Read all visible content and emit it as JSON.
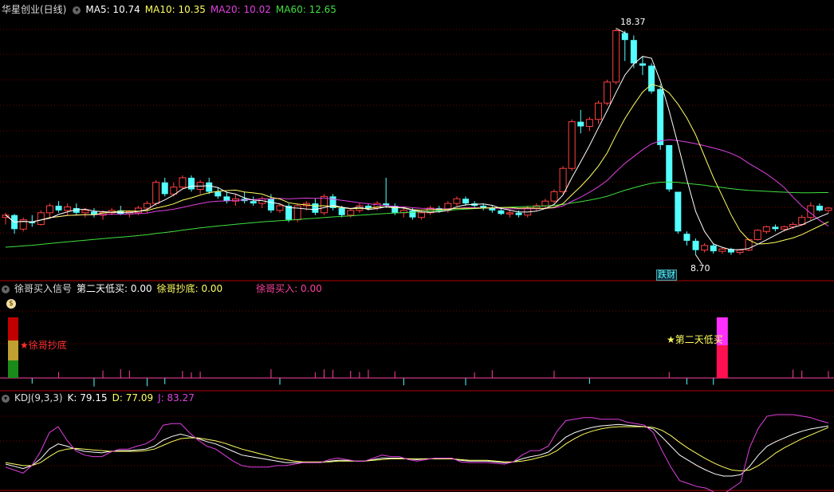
{
  "main_header": {
    "stock": "华星创业(日线)",
    "ma5": "MA5: 10.74",
    "ma10": "MA10: 10.35",
    "ma20": "MA20: 10.02",
    "ma60": "MA60: 12.65"
  },
  "signal_header": {
    "name": "徐哥买入信号",
    "day2": "第二天低买: 0.00",
    "bottom": "徐哥抄底: 0.00",
    "buy": "徐哥买入: 0.00"
  },
  "kdj_header": {
    "name": "KDJ(9,3,3)",
    "k": "K: 79.15",
    "d": "D: 77.09",
    "j": "J: 83.27"
  },
  "annotations": {
    "high": "18.37",
    "low": "8.70",
    "badge": "跌财",
    "signal1": "★徐哥抄底",
    "signal2": "★第二天低买"
  },
  "colors": {
    "up": "#ff4040",
    "down": "#54ffff",
    "ma5": "#ffffff",
    "ma10": "#ffff60",
    "ma20": "#e040e0",
    "ma60": "#40e040",
    "grid": "#7a0000",
    "axis": "#b00000"
  },
  "chart_data": [
    {
      "type": "candlestick",
      "title": "华星创业(日线)",
      "ylim": [
        8.0,
        19.0
      ],
      "candles": [
        [
          10.3,
          10.5,
          10.0,
          10.4
        ],
        [
          10.4,
          10.45,
          9.6,
          9.8
        ],
        [
          9.8,
          10.3,
          9.7,
          10.2
        ],
        [
          10.1,
          10.4,
          9.9,
          10.05
        ],
        [
          10.0,
          10.6,
          9.95,
          10.5
        ],
        [
          10.5,
          10.9,
          10.3,
          10.8
        ],
        [
          10.8,
          11.0,
          10.5,
          10.6
        ],
        [
          10.6,
          10.9,
          10.4,
          10.75
        ],
        [
          10.7,
          10.9,
          10.4,
          10.5
        ],
        [
          10.5,
          10.7,
          10.3,
          10.6
        ],
        [
          10.55,
          10.7,
          10.3,
          10.4
        ],
        [
          10.4,
          10.6,
          10.2,
          10.5
        ],
        [
          10.5,
          10.7,
          10.4,
          10.6
        ],
        [
          10.6,
          10.8,
          10.4,
          10.45
        ],
        [
          10.45,
          10.6,
          10.3,
          10.55
        ],
        [
          10.5,
          10.8,
          10.4,
          10.7
        ],
        [
          10.7,
          11.0,
          10.5,
          10.9
        ],
        [
          10.9,
          11.9,
          10.8,
          11.8
        ],
        [
          11.8,
          12.0,
          11.2,
          11.3
        ],
        [
          11.3,
          11.8,
          11.2,
          11.6
        ],
        [
          11.6,
          12.1,
          11.5,
          12.0
        ],
        [
          12.0,
          12.1,
          11.4,
          11.5
        ],
        [
          11.5,
          11.9,
          11.3,
          11.8
        ],
        [
          11.8,
          12.0,
          11.3,
          11.4
        ],
        [
          11.4,
          11.6,
          11.1,
          11.2
        ],
        [
          11.2,
          11.4,
          10.9,
          11.0
        ],
        [
          11.0,
          11.3,
          10.8,
          11.1
        ],
        [
          11.1,
          11.4,
          10.9,
          11.0
        ],
        [
          11.0,
          11.2,
          10.8,
          10.9
        ],
        [
          10.9,
          11.2,
          10.7,
          11.1
        ],
        [
          11.1,
          11.3,
          10.5,
          10.6
        ],
        [
          10.6,
          10.9,
          10.5,
          10.8
        ],
        [
          10.8,
          10.9,
          10.1,
          10.2
        ],
        [
          10.2,
          10.9,
          10.1,
          10.8
        ],
        [
          10.8,
          11.0,
          10.6,
          10.9
        ],
        [
          10.9,
          11.1,
          10.4,
          10.5
        ],
        [
          10.5,
          11.3,
          10.4,
          11.2
        ],
        [
          11.2,
          11.3,
          10.6,
          10.7
        ],
        [
          10.7,
          10.8,
          10.3,
          10.4
        ],
        [
          10.4,
          10.7,
          10.3,
          10.6
        ],
        [
          10.6,
          10.9,
          10.5,
          10.8
        ],
        [
          10.8,
          10.9,
          10.6,
          10.7
        ],
        [
          10.7,
          11.0,
          10.6,
          10.9
        ],
        [
          10.9,
          12.0,
          10.7,
          10.8
        ],
        [
          10.8,
          10.9,
          10.4,
          10.5
        ],
        [
          10.5,
          10.7,
          10.3,
          10.6
        ],
        [
          10.6,
          10.7,
          10.2,
          10.3
        ],
        [
          10.3,
          10.6,
          10.2,
          10.5
        ],
        [
          10.5,
          10.8,
          10.4,
          10.7
        ],
        [
          10.7,
          10.8,
          10.5,
          10.6
        ],
        [
          10.6,
          11.0,
          10.5,
          10.9
        ],
        [
          10.9,
          11.2,
          10.8,
          11.1
        ],
        [
          11.1,
          11.2,
          10.8,
          10.9
        ],
        [
          10.9,
          11.0,
          10.7,
          10.8
        ],
        [
          10.8,
          10.9,
          10.6,
          10.7
        ],
        [
          10.7,
          10.8,
          10.5,
          10.6
        ],
        [
          10.6,
          10.7,
          10.4,
          10.45
        ],
        [
          10.45,
          10.6,
          10.3,
          10.5
        ],
        [
          10.5,
          10.6,
          10.3,
          10.4
        ],
        [
          10.4,
          10.8,
          10.3,
          10.7
        ],
        [
          10.7,
          10.9,
          10.6,
          10.8
        ],
        [
          10.8,
          11.1,
          10.7,
          11.0
        ],
        [
          11.0,
          11.5,
          10.9,
          11.4
        ],
        [
          11.4,
          12.5,
          11.3,
          12.4
        ],
        [
          12.4,
          14.5,
          12.3,
          14.4
        ],
        [
          14.4,
          14.9,
          13.9,
          14.2
        ],
        [
          14.2,
          14.6,
          14.0,
          14.5
        ],
        [
          14.5,
          15.3,
          14.3,
          15.2
        ],
        [
          15.2,
          16.2,
          15.1,
          16.1
        ],
        [
          16.1,
          18.4,
          16.0,
          18.3
        ],
        [
          18.2,
          18.3,
          17.0,
          17.9
        ],
        [
          17.9,
          18.1,
          16.7,
          16.9
        ],
        [
          16.9,
          17.2,
          16.4,
          16.8
        ],
        [
          16.8,
          16.9,
          15.6,
          15.7
        ],
        [
          15.8,
          16.0,
          13.2,
          13.4
        ],
        [
          13.4,
          13.4,
          11.4,
          11.5
        ],
        [
          11.4,
          11.4,
          9.6,
          9.7
        ],
        [
          9.6,
          9.7,
          9.1,
          9.3
        ],
        [
          9.3,
          9.4,
          8.7,
          8.9
        ],
        [
          8.9,
          9.2,
          8.8,
          9.1
        ],
        [
          9.1,
          9.2,
          8.75,
          8.85
        ],
        [
          8.85,
          9.0,
          8.75,
          8.95
        ],
        [
          8.95,
          9.0,
          8.7,
          8.8
        ],
        [
          8.8,
          8.95,
          8.7,
          8.9
        ],
        [
          8.9,
          9.4,
          8.85,
          9.35
        ],
        [
          9.35,
          9.8,
          9.3,
          9.75
        ],
        [
          9.7,
          9.95,
          9.6,
          9.9
        ],
        [
          9.9,
          10.0,
          9.7,
          9.8
        ],
        [
          9.8,
          9.95,
          9.7,
          9.9
        ],
        [
          9.9,
          10.1,
          9.8,
          10.0
        ],
        [
          10.0,
          10.4,
          9.95,
          10.3
        ],
        [
          10.3,
          10.95,
          10.2,
          10.8
        ],
        [
          10.8,
          10.9,
          10.55,
          10.6
        ],
        [
          10.6,
          10.75,
          10.5,
          10.7
        ]
      ]
    },
    {
      "type": "bar",
      "title": "徐哥买入信号",
      "ylim": [
        -1,
        10
      ],
      "signals": [
        {
          "index": 1,
          "value": 10,
          "label": "徐哥抄底"
        },
        {
          "index": 81,
          "value": 8,
          "label": "第二天低买"
        }
      ]
    },
    {
      "type": "line",
      "title": "KDJ(9,3,3)",
      "ylim": [
        -5,
        110
      ],
      "series": [
        {
          "name": "K",
          "values": [
            28,
            25,
            22,
            26,
            35,
            48,
            55,
            52,
            48,
            45,
            44,
            43,
            45,
            46,
            46,
            47,
            48,
            52,
            60,
            65,
            68,
            65,
            62,
            58,
            55,
            50,
            45,
            40,
            38,
            36,
            34,
            32,
            30,
            30,
            30,
            30,
            30,
            32,
            33,
            33,
            32,
            32,
            34,
            36,
            36,
            36,
            35,
            34,
            35,
            35,
            35,
            35,
            33,
            32,
            32,
            32,
            31,
            30,
            31,
            35,
            38,
            40,
            44,
            54,
            64,
            70,
            74,
            77,
            79,
            80,
            81,
            80,
            79,
            78,
            75,
            64,
            52,
            40,
            33,
            26,
            20,
            15,
            12,
            12,
            14,
            25,
            40,
            52,
            58,
            63,
            68,
            72,
            75,
            77,
            79
          ]
        },
        {
          "name": "D",
          "values": [
            30,
            28,
            26,
            26,
            30,
            38,
            45,
            48,
            49,
            48,
            47,
            46,
            45,
            45,
            45,
            45,
            46,
            48,
            53,
            58,
            62,
            63,
            63,
            61,
            59,
            56,
            52,
            48,
            45,
            42,
            39,
            36,
            34,
            32,
            31,
            31,
            31,
            31,
            32,
            32,
            32,
            32,
            33,
            34,
            35,
            35,
            35,
            35,
            35,
            35,
            35,
            35,
            34,
            33,
            33,
            33,
            32,
            31,
            31,
            32,
            34,
            37,
            40,
            46,
            55,
            62,
            68,
            72,
            75,
            77,
            78,
            78,
            78,
            78,
            77,
            73,
            66,
            57,
            49,
            42,
            35,
            29,
            24,
            20,
            19,
            20,
            26,
            34,
            43,
            50,
            56,
            62,
            67,
            72,
            77
          ]
        },
        {
          "name": "J",
          "values": [
            24,
            20,
            16,
            26,
            45,
            70,
            78,
            60,
            46,
            40,
            38,
            38,
            44,
            48,
            48,
            52,
            55,
            62,
            80,
            82,
            82,
            70,
            60,
            52,
            48,
            40,
            32,
            26,
            24,
            24,
            24,
            26,
            26,
            28,
            30,
            30,
            30,
            34,
            36,
            34,
            32,
            32,
            36,
            40,
            38,
            38,
            34,
            32,
            34,
            36,
            36,
            36,
            31,
            30,
            30,
            30,
            29,
            28,
            31,
            40,
            46,
            46,
            52,
            72,
            86,
            88,
            90,
            90,
            88,
            88,
            88,
            84,
            82,
            80,
            70,
            46,
            24,
            6,
            2,
            -2,
            -4,
            -10,
            -12,
            -4,
            4,
            50,
            76,
            92,
            94,
            94,
            94,
            92,
            90,
            86,
            83
          ]
        }
      ]
    }
  ]
}
